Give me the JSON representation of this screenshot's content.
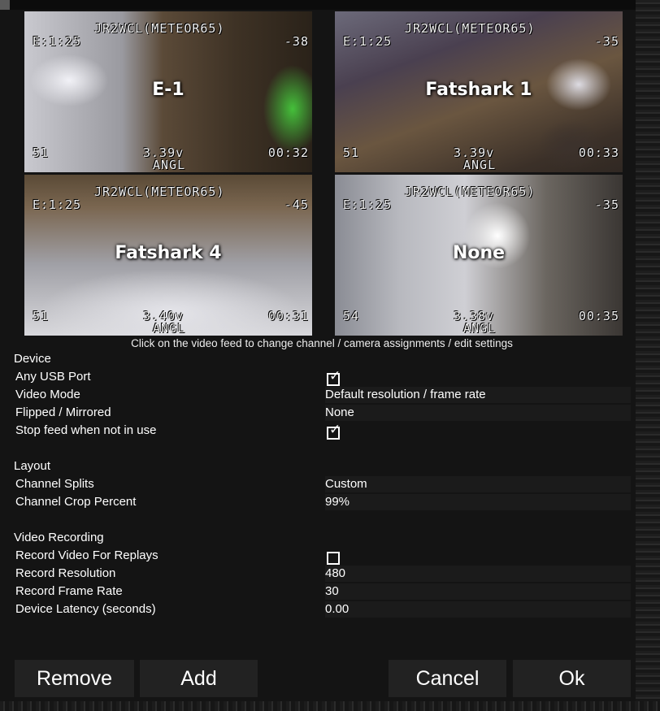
{
  "colors": {
    "background": "#151515",
    "value_field": "#1b1b1b",
    "button": "#222222",
    "text": "#ffffff"
  },
  "feeds": [
    {
      "label": "E-1",
      "osd": {
        "callsign": "JR2WCL(METEOR65)",
        "e": "E:1:25",
        "rssi": "-38",
        "signal": "51",
        "voltage": "3.39v",
        "time": "00:32",
        "mode": "ANGL"
      }
    },
    {
      "label": "Fatshark 1",
      "osd": {
        "callsign": "JR2WCL(METEOR65)",
        "e": "E:1:25",
        "rssi": "-35",
        "signal": "51",
        "voltage": "3.39v",
        "time": "00:33",
        "mode": "ANGL"
      }
    },
    {
      "label": "Fatshark 4",
      "osd": {
        "callsign": "JR2WCL(METEOR65)",
        "e": "E:1:25",
        "rssi": "-45",
        "signal": "51",
        "voltage": "3.40v",
        "time": "00:31",
        "mode": "ANGL"
      }
    },
    {
      "label": "None",
      "osd": {
        "callsign": "JR2WCL(METEOR65)",
        "e": "E:1:25",
        "rssi": "-35",
        "signal": "54",
        "voltage": "3.38v",
        "time": "00:35",
        "mode": "ANGL"
      }
    }
  ],
  "hint": "Click on the video feed to change channel / camera assignments / edit settings",
  "device": {
    "heading": "Device",
    "any_usb_port": {
      "label": "Any USB Port",
      "checked": true
    },
    "video_mode": {
      "label": "Video Mode",
      "value": "Default resolution / frame rate"
    },
    "flipped": {
      "label": "Flipped / Mirrored",
      "value": "None"
    },
    "stop_feed": {
      "label": "Stop feed when not in use",
      "checked": true
    }
  },
  "layout": {
    "heading": "Layout",
    "channel_splits": {
      "label": "Channel Splits",
      "value": "Custom"
    },
    "crop_percent": {
      "label": "Channel Crop Percent",
      "value": "99%"
    }
  },
  "recording": {
    "heading": "Video Recording",
    "record_video": {
      "label": "Record Video For Replays",
      "checked": false
    },
    "resolution": {
      "label": "Record Resolution",
      "value": "480"
    },
    "frame_rate": {
      "label": "Record Frame Rate",
      "value": "30"
    },
    "latency": {
      "label": "Device Latency (seconds)",
      "value": "0.00"
    }
  },
  "buttons": {
    "remove": "Remove",
    "add": "Add",
    "cancel": "Cancel",
    "ok": "Ok"
  },
  "tick_glyph": "✓"
}
